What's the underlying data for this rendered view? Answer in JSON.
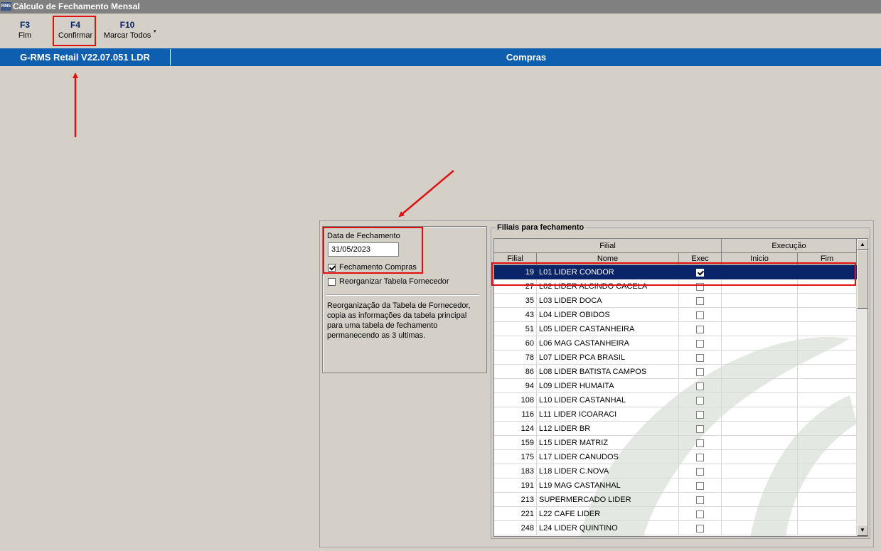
{
  "window": {
    "title": "Cálculo de Fechamento Mensal",
    "icon_text": "RMS"
  },
  "toolbar": {
    "buttons": [
      {
        "key": "F3",
        "label": "Fim"
      },
      {
        "key": "F4",
        "label": "Confirmar"
      },
      {
        "key": "F10",
        "label": "Marcar Todos"
      }
    ],
    "dropdown_icon": "▾"
  },
  "statusbar": {
    "version": "G-RMS Retail V22.07.051 LDR",
    "module": "Compras"
  },
  "form": {
    "date_label": "Data de Fechamento",
    "date_value": "31/05/2023",
    "chk_fechamento_compras": {
      "label": "Fechamento Compras",
      "checked": true
    },
    "chk_reorganizar": {
      "label": "Reorganizar Tabela Fornecedor",
      "checked": false
    },
    "description": "Reorganização da Tabela de Fornecedor, copia as informações da tabela principal para uma tabela de fechamento permanecendo as 3 ultimas."
  },
  "grid": {
    "group_title": "Filiais para fechamento",
    "group_headers": {
      "filial": "Filial",
      "execucao": "Execução"
    },
    "columns": {
      "filial": "Filial",
      "nome": "Nome",
      "exec": "Exec",
      "inicio": "Inicio",
      "fim": "Fim"
    },
    "rows": [
      {
        "filial": "19",
        "nome": "L01 LIDER CONDOR",
        "exec": true,
        "selected": true
      },
      {
        "filial": "27",
        "nome": "L02 LIDER ALCINDO CACELA",
        "exec": false
      },
      {
        "filial": "35",
        "nome": "L03 LIDER DOCA",
        "exec": false
      },
      {
        "filial": "43",
        "nome": "L04 LIDER OBIDOS",
        "exec": false
      },
      {
        "filial": "51",
        "nome": "L05 LIDER CASTANHEIRA",
        "exec": false
      },
      {
        "filial": "60",
        "nome": "L06 MAG CASTANHEIRA",
        "exec": false
      },
      {
        "filial": "78",
        "nome": "L07 LIDER PCA BRASIL",
        "exec": false
      },
      {
        "filial": "86",
        "nome": "L08 LIDER BATISTA CAMPOS",
        "exec": false
      },
      {
        "filial": "94",
        "nome": "L09 LIDER HUMAITA",
        "exec": false
      },
      {
        "filial": "108",
        "nome": "L10 LIDER CASTANHAL",
        "exec": false
      },
      {
        "filial": "116",
        "nome": "L11 LIDER ICOARACI",
        "exec": false
      },
      {
        "filial": "124",
        "nome": "L12 LIDER BR",
        "exec": false
      },
      {
        "filial": "159",
        "nome": "L15 LIDER MATRIZ",
        "exec": false
      },
      {
        "filial": "175",
        "nome": "L17 LIDER CANUDOS",
        "exec": false
      },
      {
        "filial": "183",
        "nome": "L18 LIDER C.NOVA",
        "exec": false
      },
      {
        "filial": "191",
        "nome": "L19 MAG CASTANHAL",
        "exec": false
      },
      {
        "filial": "213",
        "nome": "SUPERMERCADO LIDER",
        "exec": false
      },
      {
        "filial": "221",
        "nome": "L22 CAFE LIDER",
        "exec": false
      },
      {
        "filial": "248",
        "nome": "L24 LIDER QUINTINO",
        "exec": false
      }
    ],
    "scroll_up_icon": "▲",
    "scroll_down_icon": "▼"
  },
  "annotations": {
    "color": "#e01010"
  }
}
